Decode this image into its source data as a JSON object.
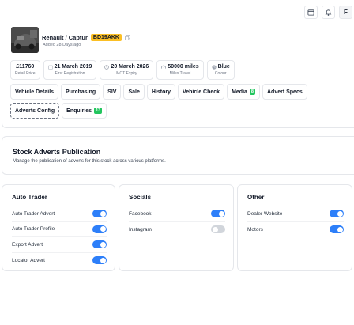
{
  "topbar": {
    "avatar_initial": "F",
    "icons": [
      "calendar-icon",
      "bell-icon"
    ]
  },
  "vehicle": {
    "name": "Renault / Captur",
    "registration": "BD19AKK",
    "added": "Added 28 Days ago",
    "stats": [
      {
        "icon": "price-tag",
        "value": "£11760",
        "label": "Retail Price"
      },
      {
        "icon": "calendar-icon",
        "value": "21 March 2019",
        "label": "First Registration"
      },
      {
        "icon": "mot-icon",
        "value": "20 March 2026",
        "label": "MOT Expiry"
      },
      {
        "icon": "gauge-icon",
        "value": "50000 miles",
        "label": "Miles Travel"
      },
      {
        "icon": "palette-icon",
        "value": "Blue",
        "label": "Colour"
      }
    ]
  },
  "tabs": [
    {
      "label": "Vehicle Details"
    },
    {
      "label": "Purchasing"
    },
    {
      "label": "SIV"
    },
    {
      "label": "Sale"
    },
    {
      "label": "History"
    },
    {
      "label": "Vehicle Check"
    },
    {
      "label": "Media",
      "count": "8"
    },
    {
      "label": "Advert Specs"
    },
    {
      "label": "Adverts Config",
      "active": true
    },
    {
      "label": "Enquiries",
      "count": "13"
    }
  ],
  "publication": {
    "title": "Stock Adverts Publication",
    "description": "Manage the publication of adverts for this stock across various platforms."
  },
  "platforms": [
    {
      "title": "Auto Trader",
      "items": [
        {
          "label": "Auto Trader Advert",
          "enabled": true
        },
        {
          "label": "Auto Trader Profile",
          "enabled": true
        },
        {
          "label": "Export Advert",
          "enabled": true
        },
        {
          "label": "Locator Advert",
          "enabled": true
        }
      ]
    },
    {
      "title": "Socials",
      "items": [
        {
          "label": "Facebook",
          "enabled": true
        },
        {
          "label": "Instagram",
          "enabled": false
        }
      ]
    },
    {
      "title": "Other",
      "items": [
        {
          "label": "Dealer Website",
          "enabled": true
        },
        {
          "label": "Motors",
          "enabled": true
        }
      ]
    }
  ],
  "colors": {
    "accent": "#2d7ff9",
    "badge_yellow": "#fbbf24",
    "count_green": "#22c55e",
    "toggle_off": "#d1d5db"
  }
}
